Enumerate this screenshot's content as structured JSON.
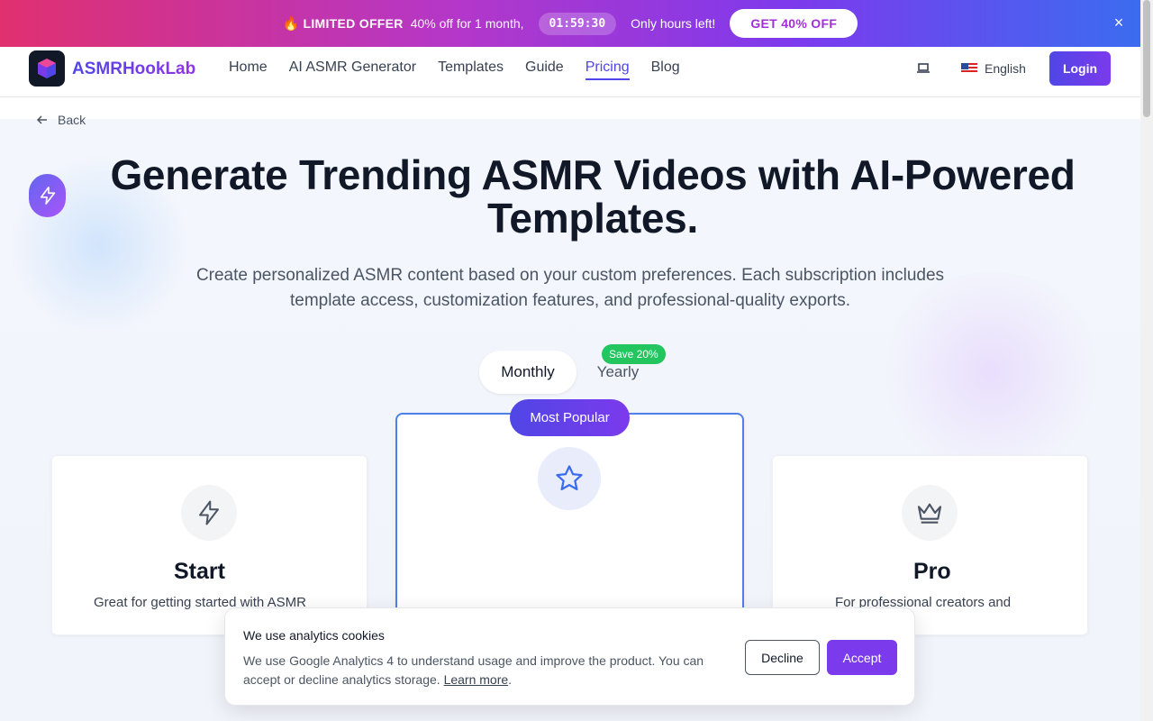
{
  "promo": {
    "fire": "🔥",
    "offer_label": "LIMITED OFFER",
    "offer_detail": "40% off for 1 month,",
    "timer": "01:59:30",
    "hours_left": "Only hours left!",
    "cta": "GET 40% OFF",
    "close": "×"
  },
  "header": {
    "brand": "ASMRHookLab",
    "nav": [
      "Home",
      "AI ASMR Generator",
      "Templates",
      "Guide",
      "Pricing",
      "Blog"
    ],
    "active_nav": "Pricing",
    "language": "English",
    "login": "Login"
  },
  "hero": {
    "back": "Back",
    "title": "Generate Trending ASMR Videos with AI-Powered Templates.",
    "subtitle": "Create personalized ASMR content based on your custom preferences. Each subscription includes template access, customization features, and professional-quality exports."
  },
  "billing": {
    "monthly": "Monthly",
    "yearly": "Yearly",
    "save_badge": "Save 20%",
    "selected": "Monthly"
  },
  "plans": {
    "popular_badge": "Most Popular",
    "left": {
      "name": "Start",
      "desc": "Great for getting started with ASMR"
    },
    "right": {
      "name": "Pro",
      "desc": "For professional creators and"
    }
  },
  "cookie": {
    "title": "We use analytics cookies",
    "body": "We use Google Analytics 4 to understand usage and improve the product. You can accept or decline analytics storage.",
    "learn_more": "Learn more",
    "decline": "Decline",
    "accept": "Accept"
  },
  "colors": {
    "accent": "#4f46e5",
    "accent2": "#7c3aed",
    "save_green": "#22c55e"
  }
}
